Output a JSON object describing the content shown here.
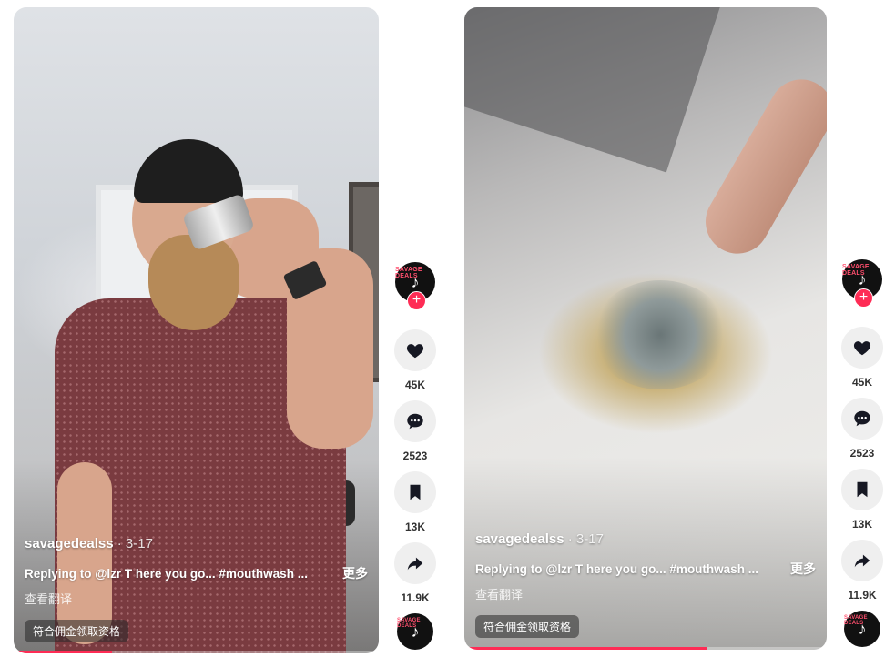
{
  "videos": [
    {
      "author": "savagedealss",
      "date": "· 3-17",
      "caption": "Replying to @lzr T here you go... #mouthwash ...",
      "more_label": "更多",
      "translate_label": "查看翻译",
      "badge": "符合佣金领取资格",
      "progress": 0.27,
      "cap_text": "",
      "actions": {
        "likes": "45K",
        "comments": "2523",
        "saves": "13K",
        "shares": "11.9K"
      },
      "avatar_text": "SAVAGE DEALS"
    },
    {
      "author": "savagedealss",
      "date": "· 3-17",
      "caption": "Replying to @lzr T here you go... #mouthwash ...",
      "more_label": "更多",
      "translate_label": "查看翻译",
      "badge": "符合佣金领取资格",
      "progress": 0.67,
      "actions": {
        "likes": "45K",
        "comments": "2523",
        "saves": "13K",
        "shares": "11.9K"
      },
      "avatar_text": "SAVAGE DEALS"
    }
  ],
  "colors": {
    "accent": "#fe2c55",
    "action_bg": "#efefef"
  },
  "icons": [
    "heart-icon",
    "comment-icon",
    "bookmark-icon",
    "share-icon",
    "tiktok-logo-icon",
    "plus-icon"
  ]
}
